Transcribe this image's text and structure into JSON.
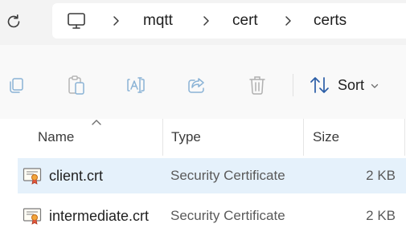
{
  "address_bar": {
    "refresh_icon": "refresh-icon",
    "root_icon": "computer-icon",
    "breadcrumbs": [
      "mqtt",
      "cert",
      "certs"
    ]
  },
  "command_bar": {
    "buttons": [
      "copy-icon",
      "paste-icon",
      "rename-icon",
      "share-icon",
      "delete-icon"
    ],
    "sort_label": "Sort"
  },
  "columns": {
    "name": "Name",
    "type": "Type",
    "size": "Size"
  },
  "files": [
    {
      "name": "client.crt",
      "type": "Security Certificate",
      "size": "2 KB",
      "selected": true,
      "icon": "certificate-icon"
    },
    {
      "name": "intermediate.crt",
      "type": "Security Certificate",
      "size": "2 KB",
      "selected": false,
      "icon": "certificate-icon"
    }
  ],
  "colors": {
    "selection": "#e5f1fb",
    "command_icon_disabled": "#8ab3d6",
    "sort_arrow": "#2b5ea7"
  }
}
